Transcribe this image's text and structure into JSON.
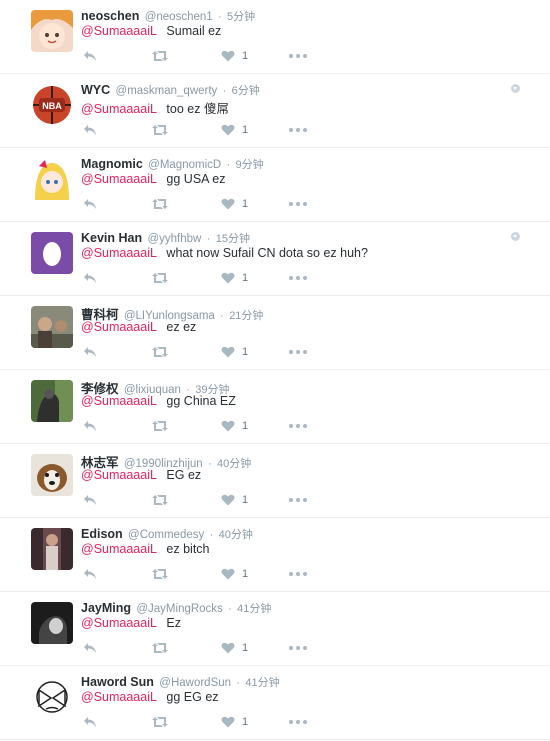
{
  "timeline": {
    "like_count": "1",
    "tweets": [
      {
        "name": "neoschen",
        "handle": "@neoschen1",
        "time": "5分钟",
        "mention": "@SumaaaaiL",
        "text": "Sumail ez"
      },
      {
        "name": "WYC",
        "handle": "@maskman_qwerty",
        "time": "6分钟",
        "mention": "@SumaaaaiL",
        "text": "too ez 傻屌"
      },
      {
        "name": "Magnomic",
        "handle": "@MagnomicD",
        "time": "9分钟",
        "mention": "@SumaaaaiL",
        "text": "gg USA ez"
      },
      {
        "name": "Kevin Han",
        "handle": "@yyhfhbw",
        "time": "15分钟",
        "mention": "@SumaaaaiL",
        "text": "what now Sufail CN dota so ez huh?"
      },
      {
        "name": "曹科柯",
        "handle": "@LIYunlongsama",
        "time": "21分钟",
        "mention": "@SumaaaaiL",
        "text": "ez  ez"
      },
      {
        "name": "李修权",
        "handle": "@lixiuquan",
        "time": "39分钟",
        "mention": "@SumaaaaiL",
        "text": "gg China EZ"
      },
      {
        "name": "林志军",
        "handle": "@1990linzhijun",
        "time": "40分钟",
        "mention": "@SumaaaaiL",
        "text": "EG ez"
      },
      {
        "name": "Edison",
        "handle": "@Commedesy",
        "time": "40分钟",
        "mention": "@SumaaaaiL",
        "text": "ez bitch"
      },
      {
        "name": "JayMing",
        "handle": "@JayMingRocks",
        "time": "41分钟",
        "mention": "@SumaaaaiL",
        "text": "Ez"
      },
      {
        "name": "Haword Sun",
        "handle": "@HawordSun",
        "time": "41分钟",
        "mention": "@SumaaaaiL",
        "text": "gg EG ez"
      }
    ]
  },
  "colors": {
    "mention": "#e0245e",
    "secondary": "#8899a6",
    "icon": "#aab8c2",
    "divider": "#e6ecf0"
  }
}
